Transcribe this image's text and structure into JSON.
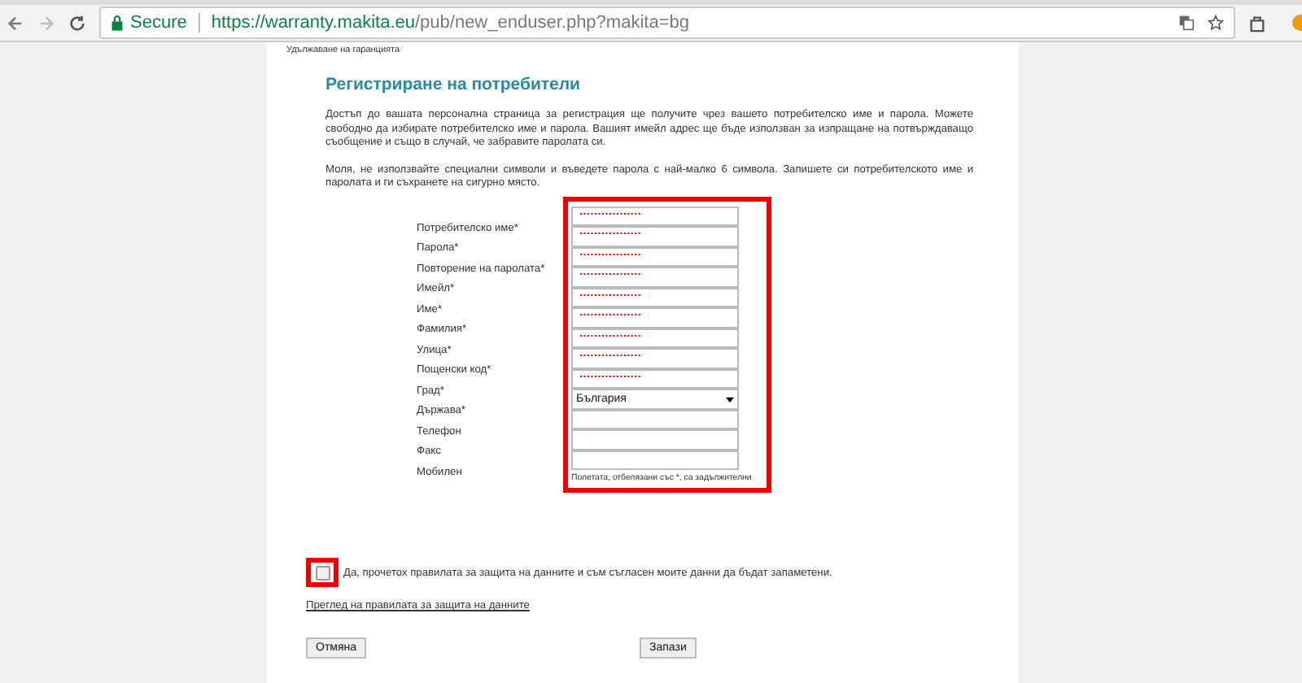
{
  "browser": {
    "secure_label": "Secure",
    "url_host": "https://warranty.makita.eu",
    "url_path": "/pub/new_enduser.php?makita=bg"
  },
  "breadcrumb": "Удължаване на гаранцията",
  "heading": "Регистриране на потребители",
  "paragraphs": [
    "Достъп до вашата персонална страница за регистрация ще получите чрез вашето потребителско име и парола. Можете свободно да избирате потребителско име и парола. Вашият имейл адрес ще бъде използван за изпращане на потвърждаващо съобщение и също в случай, че забравите паролата си.",
    "Моля, не използвайте специални символи и въведете парола с най-малко 6 символа. Запишете си потребителското име и паролата и ги съхранете на сигурно място."
  ],
  "fields": [
    {
      "label": "Потребителско име*",
      "kind": "text",
      "value": "................."
    },
    {
      "label": "Парола*",
      "kind": "text",
      "value": "................."
    },
    {
      "label": "Повторение на паролата*",
      "kind": "text",
      "value": "................."
    },
    {
      "label": "Имейл*",
      "kind": "text",
      "value": "................."
    },
    {
      "label": "Име*",
      "kind": "text",
      "value": "................."
    },
    {
      "label": "Фамилия*",
      "kind": "text",
      "value": "................."
    },
    {
      "label": "Улица*",
      "kind": "text",
      "value": "................."
    },
    {
      "label": "Пощенски код*",
      "kind": "text",
      "value": "................."
    },
    {
      "label": "Град*",
      "kind": "text",
      "value": "................."
    },
    {
      "label": "Държава*",
      "kind": "select",
      "value": "България"
    },
    {
      "label": "Телефон",
      "kind": "text"
    },
    {
      "label": "Факс",
      "kind": "text"
    },
    {
      "label": "Мобилен",
      "kind": "text"
    }
  ],
  "required_note": "Полетата, отбелязани със *, са задължителни",
  "consent": {
    "checked": false,
    "text": "Да, прочетох правилата за защита на данните и съм съгласен моите данни да бъдат запаметени."
  },
  "privacy_link": "Преглед на правилата за защита на данните",
  "buttons": [
    "Отмяна",
    "Запази"
  ]
}
